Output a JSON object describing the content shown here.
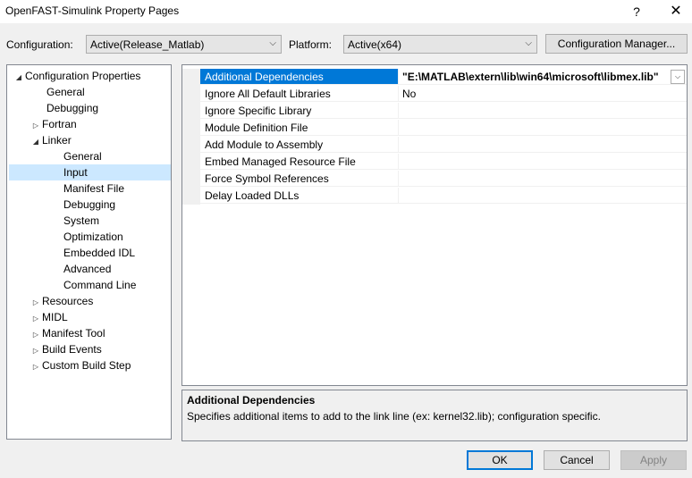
{
  "window": {
    "title": "OpenFAST-Simulink Property Pages",
    "help_glyph": "?",
    "close_glyph": "✕"
  },
  "toolbar": {
    "configuration_label": "Configuration:",
    "configuration_value": "Active(Release_Matlab)",
    "platform_label": "Platform:",
    "platform_value": "Active(x64)",
    "config_manager_label": "Configuration Manager..."
  },
  "tree": [
    {
      "label": "Configuration Properties",
      "expander": "◢"
    },
    {
      "label": "General",
      "expander": ""
    },
    {
      "label": "Debugging",
      "expander": ""
    },
    {
      "label": "Fortran",
      "expander": "▷"
    },
    {
      "label": "Linker",
      "expander": "◢"
    },
    {
      "label": "General",
      "expander": ""
    },
    {
      "label": "Input",
      "expander": "",
      "selected": true
    },
    {
      "label": "Manifest File",
      "expander": ""
    },
    {
      "label": "Debugging",
      "expander": ""
    },
    {
      "label": "System",
      "expander": ""
    },
    {
      "label": "Optimization",
      "expander": ""
    },
    {
      "label": "Embedded IDL",
      "expander": ""
    },
    {
      "label": "Advanced",
      "expander": ""
    },
    {
      "label": "Command Line",
      "expander": ""
    },
    {
      "label": "Resources",
      "expander": "▷"
    },
    {
      "label": "MIDL",
      "expander": "▷"
    },
    {
      "label": "Manifest Tool",
      "expander": "▷"
    },
    {
      "label": "Build Events",
      "expander": "▷"
    },
    {
      "label": "Custom Build Step",
      "expander": "▷"
    }
  ],
  "properties": [
    {
      "name": "Additional Dependencies",
      "value": "\"E:\\MATLAB\\extern\\lib\\win64\\microsoft\\libmex.lib\"",
      "selected": true
    },
    {
      "name": "Ignore All Default Libraries",
      "value": "No"
    },
    {
      "name": "Ignore Specific Library",
      "value": ""
    },
    {
      "name": "Module Definition File",
      "value": ""
    },
    {
      "name": "Add Module to Assembly",
      "value": ""
    },
    {
      "name": "Embed Managed Resource File",
      "value": ""
    },
    {
      "name": "Force Symbol References",
      "value": ""
    },
    {
      "name": "Delay Loaded DLLs",
      "value": ""
    }
  ],
  "description": {
    "title": "Additional Dependencies",
    "text": "Specifies additional items to add to the link line (ex: kernel32.lib); configuration specific."
  },
  "buttons": {
    "ok": "OK",
    "cancel": "Cancel",
    "apply": "Apply"
  },
  "colors": {
    "selection_blue": "#0078d7",
    "tree_selection": "#cce8ff",
    "dialog_bg": "#f0f0f0"
  }
}
